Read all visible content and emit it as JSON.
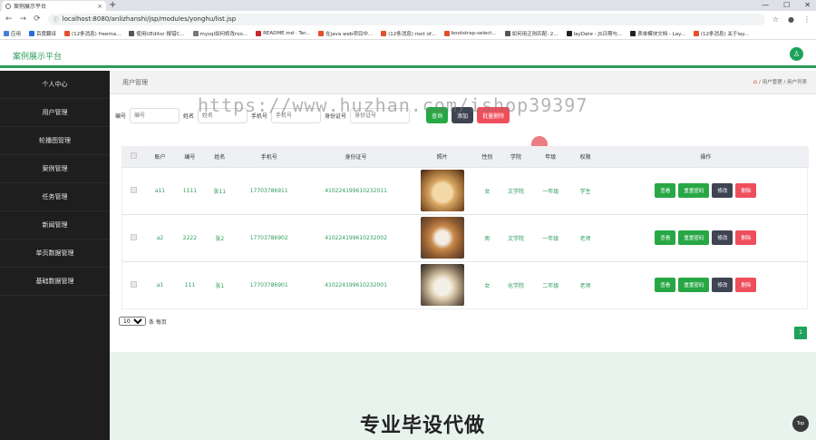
{
  "browser": {
    "tab_title": "案例展示平台",
    "tab_close": "×",
    "new_tab": "+",
    "win_minimize": "—",
    "win_maximize": "☐",
    "win_close": "✕",
    "back": "←",
    "forward": "→",
    "reload": "⟳",
    "url": "localhost:8080/anlizhanshi/jsp/modules/yonghu/list.jsp",
    "star": "☆",
    "profile": "●",
    "menu": "⋮",
    "bookmarks": [
      {
        "label": "应用",
        "color": "#4a7fd6"
      },
      {
        "label": "百度翻译",
        "color": "#2b6de0"
      },
      {
        "label": "(12条消息) freema...",
        "color": "#e2502c"
      },
      {
        "label": "使用UEditor 报错C...",
        "color": "#555555"
      },
      {
        "label": "mysql如何修改roo...",
        "color": "#777777"
      },
      {
        "label": "README.md · Ter...",
        "color": "#c7272f"
      },
      {
        "label": "在java web项目中...",
        "color": "#e2502c"
      },
      {
        "label": "(12条消息) root of...",
        "color": "#e2502c"
      },
      {
        "label": "bootstrap-select...",
        "color": "#e2502c"
      },
      {
        "label": "如何用正则匹配: 2...",
        "color": "#555555"
      },
      {
        "label": "layDate - JS日期与...",
        "color": "#222222"
      },
      {
        "label": "表单模块文档 - Lay...",
        "color": "#222222"
      },
      {
        "label": "(12条消息) 关于lay...",
        "color": "#e2502c"
      }
    ]
  },
  "app": {
    "title": "案例展示平台",
    "avatar_glyph": "♙"
  },
  "sidebar": {
    "items": [
      "个人中心",
      "用户管理",
      "轮播图管理",
      "案例管理",
      "任务管理",
      "新闻管理",
      "单页数据管理",
      "基础数据管理"
    ]
  },
  "breadcrumb": {
    "title": "用户管理",
    "home_glyph": "⌂",
    "path": "/ 用户管理 / 用户列表"
  },
  "search": {
    "label_number": "编号",
    "ph_number": "编号",
    "label_name": "姓名",
    "ph_name": "姓名",
    "label_phone": "手机号",
    "ph_phone": "手机号",
    "label_idcard": "身份证号",
    "ph_idcard": "身份证号",
    "btn_query": "查询",
    "btn_add": "添加",
    "btn_batch_delete": "批量删除"
  },
  "table": {
    "headers": [
      "账户",
      "编号",
      "姓名",
      "手机号",
      "身份证号",
      "照片",
      "性别",
      "学院",
      "年级",
      "权限",
      "操作"
    ],
    "rows": [
      {
        "account": "a11",
        "number": "1111",
        "name": "张11",
        "phone": "17703786911",
        "idcard": "410224199610232011",
        "photo": "puppy",
        "gender": "女",
        "college": "文学院",
        "grade": "一年级",
        "role": "学生"
      },
      {
        "account": "a2",
        "number": "2222",
        "name": "张2",
        "phone": "17703786902",
        "idcard": "410224199610232002",
        "photo": "shiba",
        "gender": "男",
        "college": "文学院",
        "grade": "一年级",
        "role": "老师"
      },
      {
        "account": "a1",
        "number": "111",
        "name": "张1",
        "phone": "17703786901",
        "idcard": "410224199610232001",
        "photo": "cat",
        "gender": "女",
        "college": "化学院",
        "grade": "二年级",
        "role": "老师"
      }
    ],
    "ops": {
      "view": "查看",
      "reset_pwd": "重置密码",
      "edit": "修改",
      "delete": "删除"
    }
  },
  "pager": {
    "page_size": "10",
    "per_page_text": "条 每页",
    "current_page": "1"
  },
  "promo": {
    "text": "专业毕设代做",
    "top_btn": "Top"
  },
  "watermark": "https://www.huzhan.com/ishop39397",
  "colors": {
    "brand_green": "#2e9d5a",
    "danger": "#ef4e5b",
    "dark": "#3f4452"
  }
}
